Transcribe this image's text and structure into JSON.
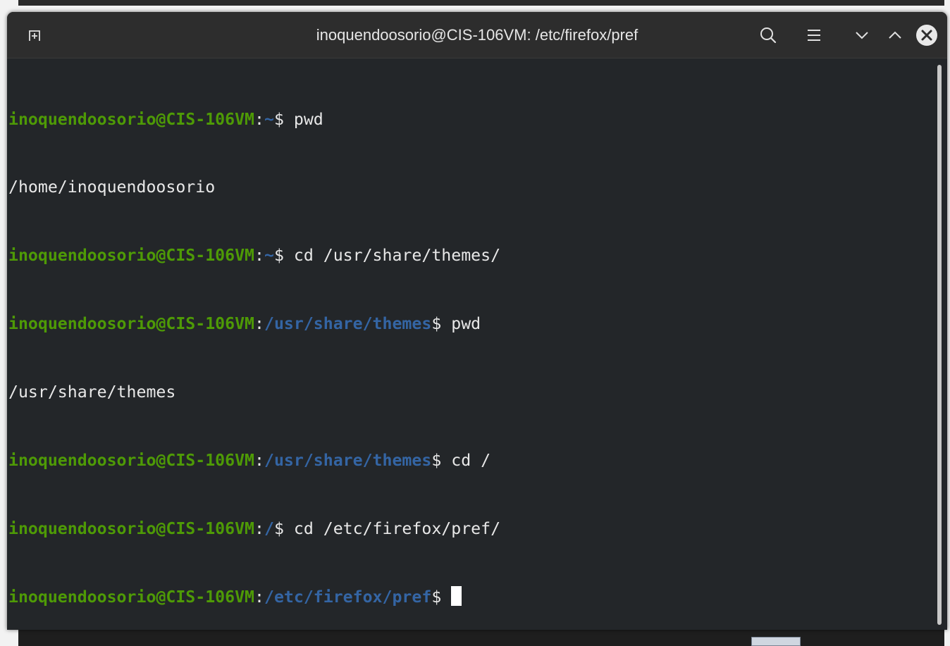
{
  "window": {
    "title": "inoquendoosorio@CIS-106VM: /etc/firefox/pref"
  },
  "icons": {
    "new_tab": "new-tab-icon",
    "search": "search-icon",
    "menu": "hamburger-menu-icon",
    "minimize": "chevron-down-icon",
    "maximize": "chevron-up-icon",
    "close": "close-icon"
  },
  "colors": {
    "prompt_user": "#4e9a06",
    "prompt_path": "#3465a4",
    "text": "#e8e8e8",
    "background": "#232629"
  },
  "terminal": {
    "lines": [
      {
        "user": "inoquendoosorio@CIS-106VM",
        "sep": ":",
        "path": "~",
        "cmd": "$ pwd"
      },
      {
        "output": "/home/inoquendoosorio"
      },
      {
        "user": "inoquendoosorio@CIS-106VM",
        "sep": ":",
        "path": "~",
        "cmd": "$ cd /usr/share/themes/"
      },
      {
        "user": "inoquendoosorio@CIS-106VM",
        "sep": ":",
        "path": "/usr/share/themes",
        "cmd": "$ pwd"
      },
      {
        "output": "/usr/share/themes"
      },
      {
        "user": "inoquendoosorio@CIS-106VM",
        "sep": ":",
        "path": "/usr/share/themes",
        "cmd": "$ cd /"
      },
      {
        "user": "inoquendoosorio@CIS-106VM",
        "sep": ":",
        "path": "/",
        "cmd": "$ cd /etc/firefox/pref/"
      },
      {
        "user": "inoquendoosorio@CIS-106VM",
        "sep": ":",
        "path": "/etc/firefox/pref",
        "cmd": "$ "
      }
    ]
  }
}
